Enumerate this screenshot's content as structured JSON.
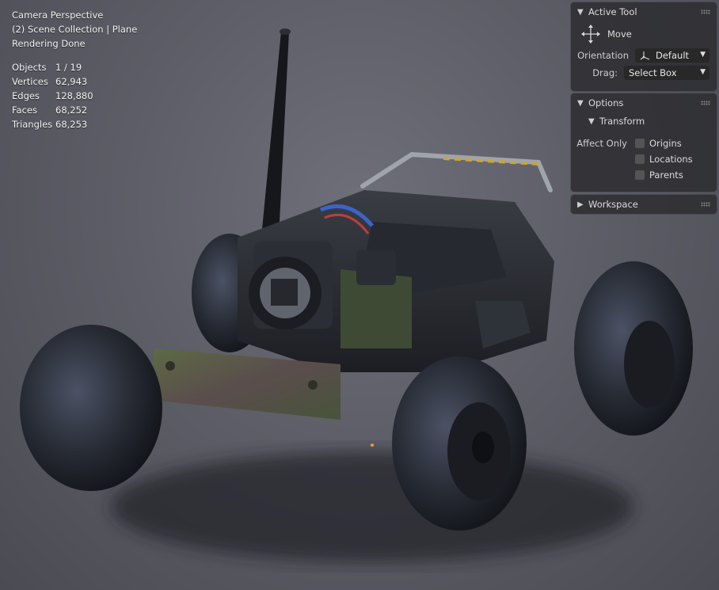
{
  "overlay": {
    "view_name": "Camera Perspective",
    "collection": "(2) Scene Collection | Plane",
    "status": "Rendering Done",
    "stats": [
      {
        "label": "Objects",
        "value": "1 / 19"
      },
      {
        "label": "Vertices",
        "value": "62,943"
      },
      {
        "label": "Edges",
        "value": "128,880"
      },
      {
        "label": "Faces",
        "value": "68,252"
      },
      {
        "label": "Triangles",
        "value": "68,253"
      }
    ]
  },
  "active_tool": {
    "title": "Active Tool",
    "tool_name": "Move",
    "tool_icon": "move-arrows-icon",
    "orientation_label": "Orientation",
    "orientation_value": "Default",
    "drag_label": "Drag:",
    "drag_value": "Select Box"
  },
  "options": {
    "title": "Options",
    "transform_title": "Transform",
    "affect_only_label": "Affect Only",
    "checkboxes": [
      {
        "label": "Origins",
        "checked": false
      },
      {
        "label": "Locations",
        "checked": false
      },
      {
        "label": "Parents",
        "checked": false
      }
    ]
  },
  "workspace": {
    "title": "Workspace"
  },
  "colors": {
    "background": "#5d5e67",
    "panel": "#303034",
    "field": "#282828",
    "checkbox": "#545454",
    "text": "#e6e6e6"
  }
}
